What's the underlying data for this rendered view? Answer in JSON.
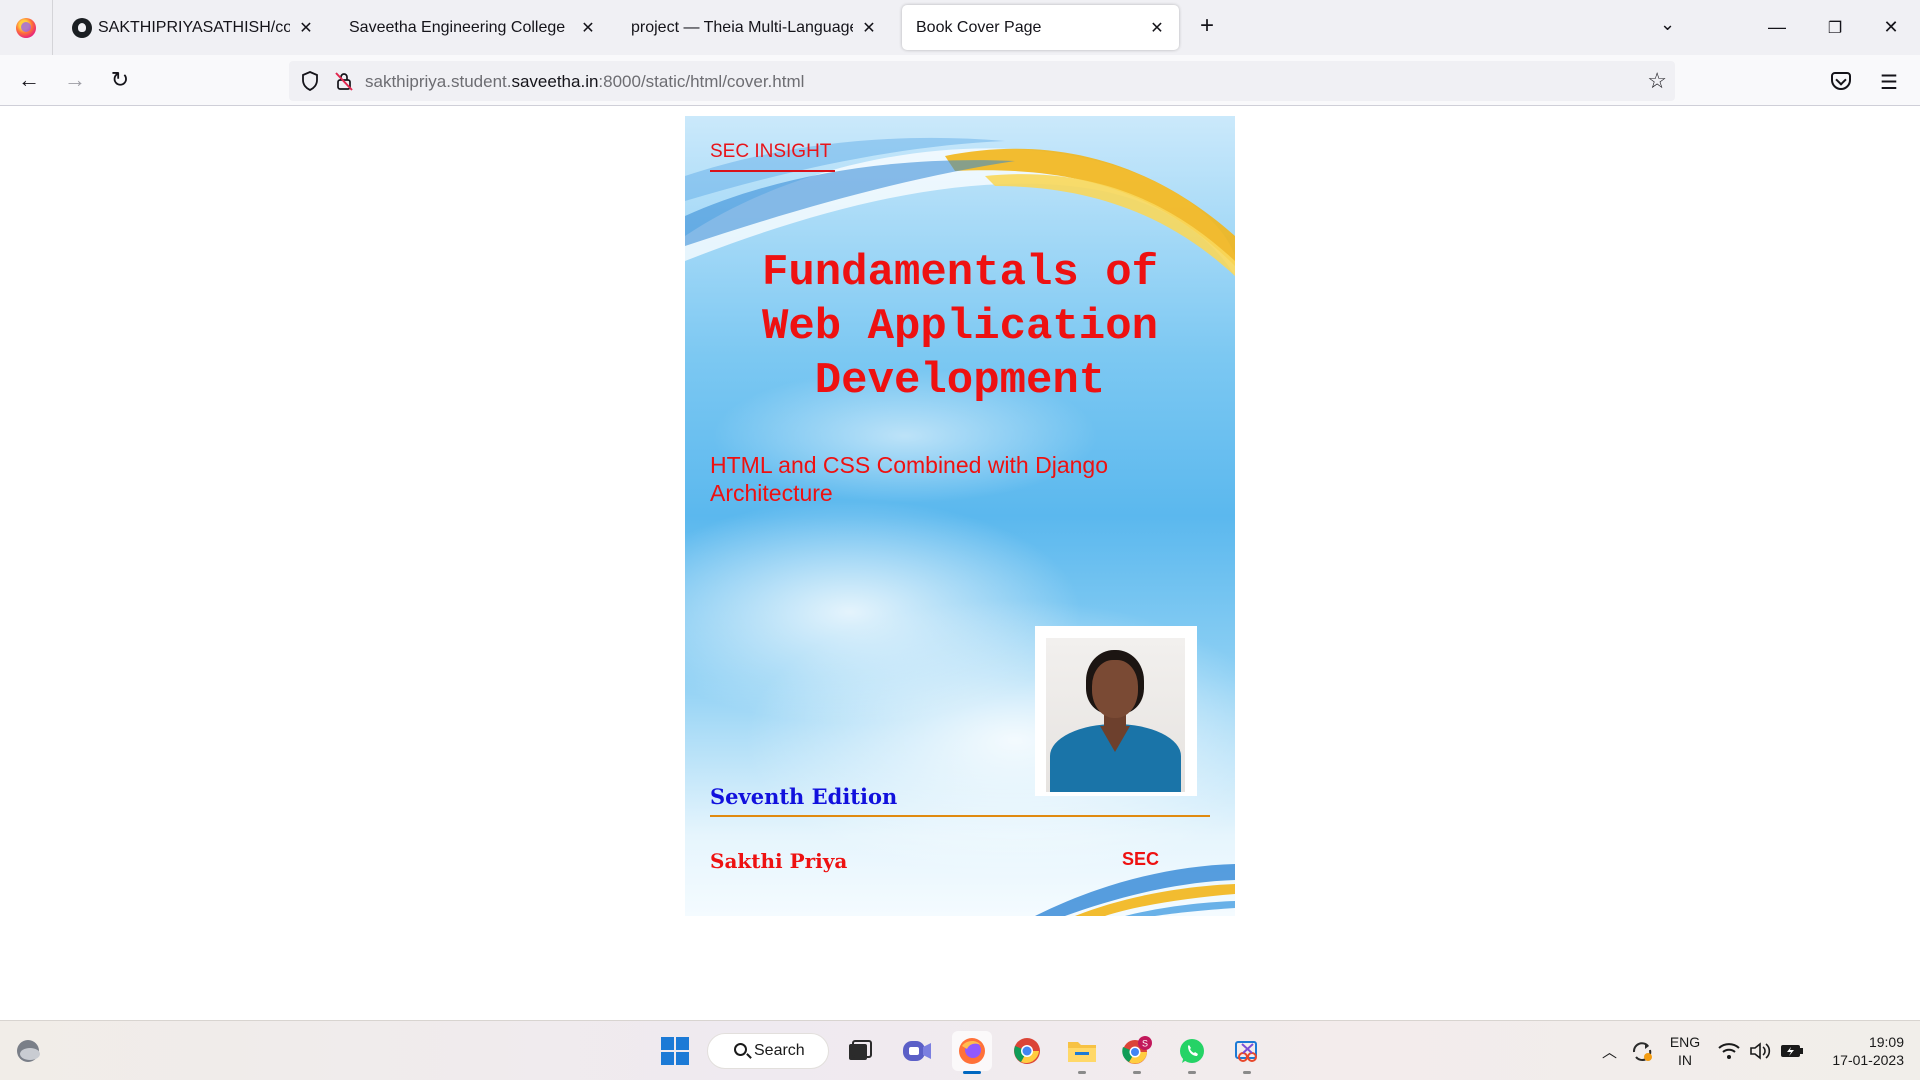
{
  "browser": {
    "tabs": [
      {
        "title": "SAKTHIPRIYASATHISH/cover",
        "favicon": "github-icon",
        "active": false
      },
      {
        "title": "Saveetha Engineering College",
        "favicon": "none",
        "active": false
      },
      {
        "title": "project — Theia Multi-Language Ex",
        "favicon": "none",
        "active": false
      },
      {
        "title": "Book Cover Page",
        "favicon": "none",
        "active": true
      }
    ],
    "url_prefix": "sakthipriya.student.",
    "url_domain": "saveetha.in",
    "url_suffix": ":8000/static/html/cover.html"
  },
  "cover": {
    "series": "SEC INSIGHT",
    "title_lines": [
      "Fundamentals of",
      "Web Application",
      "Development"
    ],
    "subtitle": "HTML and CSS Combined with Django Architecture",
    "edition": "Seventh Edition",
    "author": "Sakthi Priya",
    "publisher": "SEC",
    "colors": {
      "title": "#ee1111",
      "edition": "#1111dd",
      "rule": "#e08a10"
    }
  },
  "taskbar": {
    "search_label": "Search",
    "apps": [
      "task-view-icon",
      "teams-meet-icon",
      "firefox-icon",
      "chrome-icon",
      "file-explorer-icon",
      "chrome-profile-icon",
      "whatsapp-icon",
      "snipping-tool-icon"
    ],
    "chrome_profile_badge": "S",
    "lang_line1": "ENG",
    "lang_line2": "IN",
    "time": "19:09",
    "date": "17-01-2023"
  }
}
